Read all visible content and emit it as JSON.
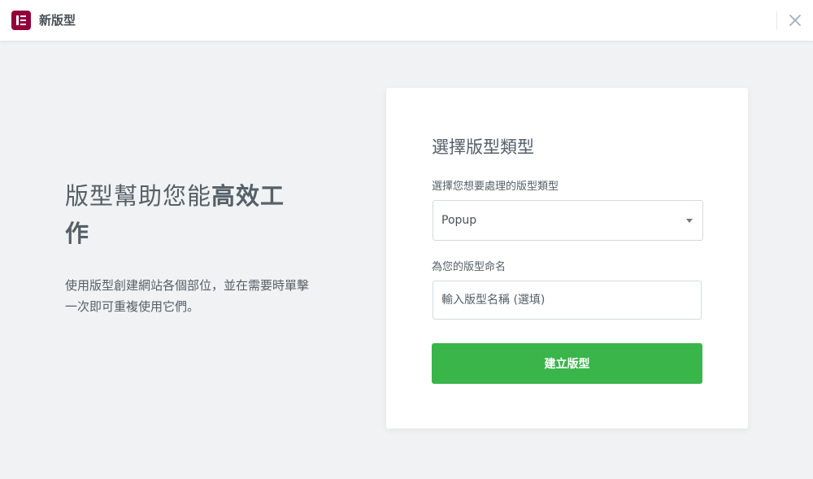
{
  "header": {
    "title": "新版型",
    "logo_icon": "elementor-logo-icon",
    "close_icon": "close-icon"
  },
  "intro": {
    "title_light": "版型幫助您能",
    "title_strong": "高效工作",
    "description": "使用版型創建網站各個部位，並在需要時單擊一次即可重複使用它們。"
  },
  "form": {
    "title": "選擇版型類型",
    "type_label": "選擇您想要處理的版型類型",
    "type_value": "Popup",
    "name_label": "為您的版型命名",
    "name_placeholder": "輸入版型名稱 (選填)",
    "submit_label": "建立版型"
  },
  "colors": {
    "logo": "#92003b",
    "button": "#39b54a",
    "background": "#f1f2f3"
  }
}
